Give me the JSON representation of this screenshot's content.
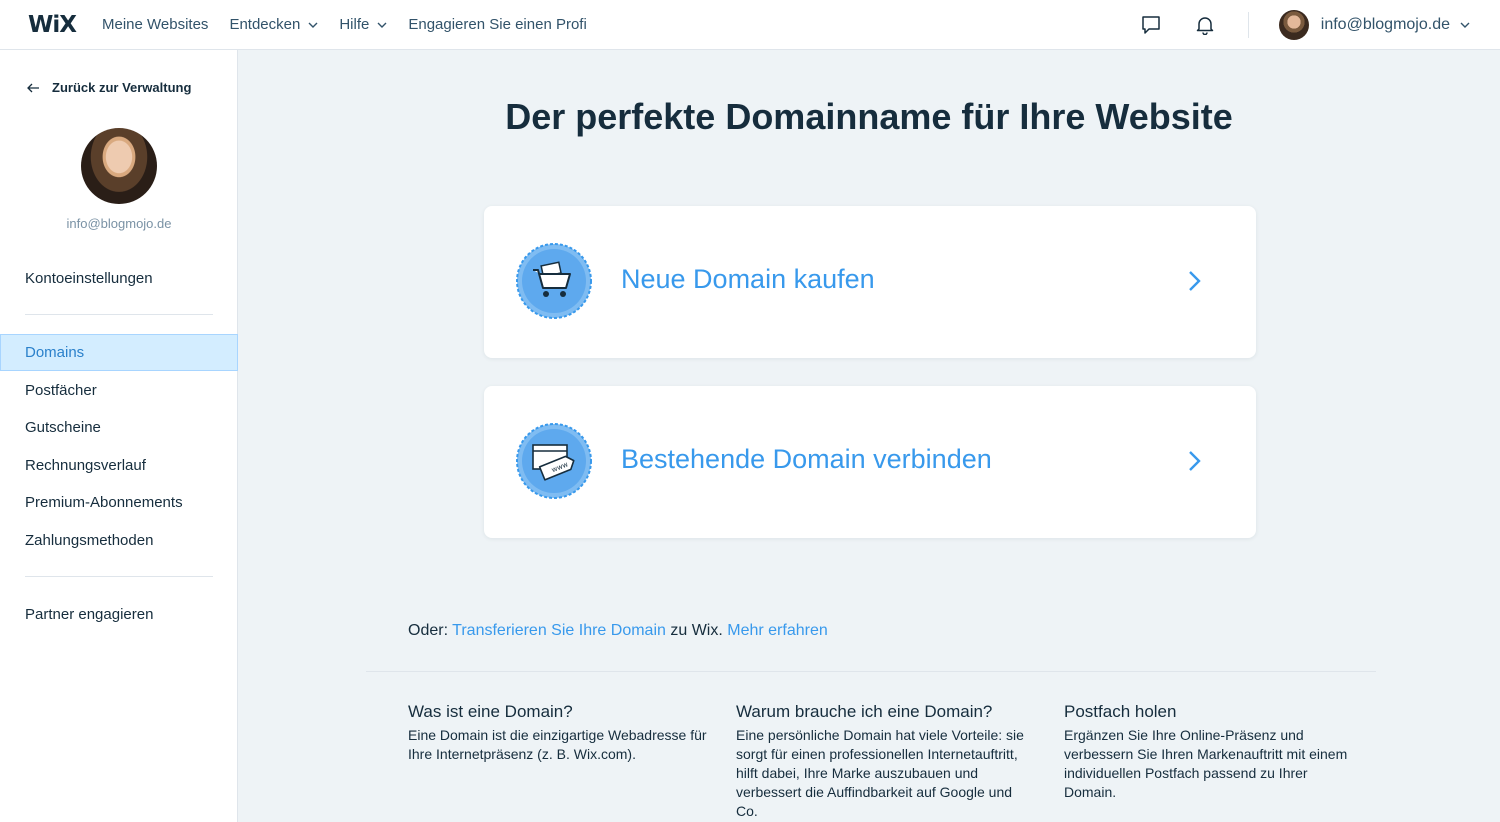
{
  "header": {
    "logo": "WiX",
    "nav": [
      {
        "label": "Meine Websites",
        "has_dropdown": false
      },
      {
        "label": "Entdecken",
        "has_dropdown": true
      },
      {
        "label": "Hilfe",
        "has_dropdown": true
      },
      {
        "label": "Engagieren Sie einen Profi",
        "has_dropdown": false
      }
    ],
    "icons": [
      "chat-icon",
      "bell-icon"
    ],
    "account_email": "info@blogmojo.de"
  },
  "sidebar": {
    "back_label": "Zurück zur Verwaltung",
    "email": "info@blogmojo.de",
    "account_settings": "Kontoeinstellungen",
    "items": [
      {
        "label": "Domains",
        "active": true
      },
      {
        "label": "Postfächer"
      },
      {
        "label": "Gutscheine"
      },
      {
        "label": "Rechnungsverlauf"
      },
      {
        "label": "Premium-Abonnements"
      },
      {
        "label": "Zahlungsmethoden"
      }
    ],
    "partner": "Partner engagieren"
  },
  "main": {
    "title": "Der perfekte Domainname für Ihre Website",
    "cards": [
      {
        "label": "Neue Domain kaufen",
        "icon": "shopping-cart-icon"
      },
      {
        "label": "Bestehende Domain verbinden",
        "icon": "www-tag-icon"
      }
    ],
    "transfer": {
      "prefix": "Oder:",
      "link1": "Transferieren Sie Ihre Domain",
      "middle": "zu Wix.",
      "link2": "Mehr erfahren"
    },
    "info": [
      {
        "title": "Was ist eine Domain?",
        "text": "Eine Domain ist die einzigartige Webadresse für Ihre Internetpräsenz (z. B. Wix.com)."
      },
      {
        "title": "Warum brauche ich eine Domain?",
        "text": "Eine persönliche Domain hat viele Vorteile: sie sorgt für einen professionellen Internetauftritt, hilft dabei, Ihre Marke auszubauen und verbessert die Auffindbarkeit auf Google und Co."
      },
      {
        "title": "Postfach holen",
        "text": "Ergänzen Sie Ihre Online-Präsenz und verbessern Sie Ihren Markenauftritt mit einem individuellen Postfach passend zu Ihrer Domain."
      }
    ]
  },
  "colors": {
    "accent": "#3899ec",
    "text": "#162d3d",
    "active_bg": "#d3edff",
    "page_bg": "#eef3f6"
  }
}
